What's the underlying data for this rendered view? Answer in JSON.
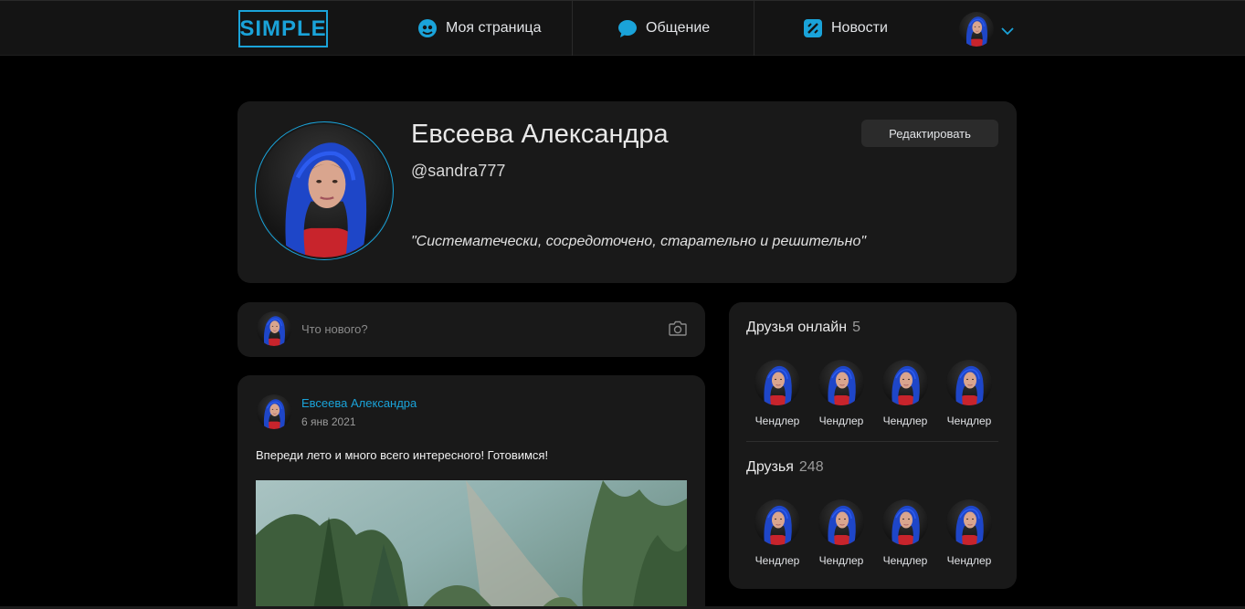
{
  "header": {
    "logo": "SIMPLE",
    "nav": [
      {
        "label": "Моя страница",
        "icon": "profile-icon"
      },
      {
        "label": "Общение",
        "icon": "chat-bubble-icon"
      },
      {
        "label": "Новости",
        "icon": "news-icon"
      }
    ],
    "accent": "#1aa3d9"
  },
  "profile": {
    "name": "Евсеева Александра",
    "handle": "@sandra777",
    "quote": "\"Систематечески, сосредоточено, старательно и решительно\"",
    "edit_label": "Редактировать"
  },
  "new_post": {
    "placeholder": "Что нового?"
  },
  "post": {
    "author": "Евсеева Александра",
    "date": "6 янв 2021",
    "text": "Впереди лето и много всего интересного! Готовимся!"
  },
  "friends_online": {
    "title": "Друзья онлайн",
    "count": "5",
    "items": [
      "Чендлер",
      "Чендлер",
      "Чендлер",
      "Чендлер"
    ]
  },
  "friends": {
    "title": "Друзья",
    "count": "248",
    "items": [
      "Чендлер",
      "Чендлер",
      "Чендлер",
      "Чендлер"
    ]
  }
}
